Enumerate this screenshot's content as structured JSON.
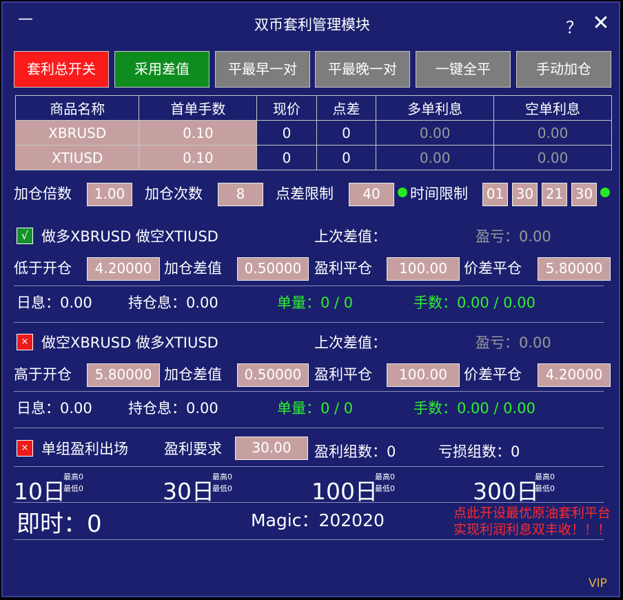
{
  "window": {
    "title": "双币套利管理模块",
    "minimize": "—",
    "help": "？",
    "close": "✕"
  },
  "toolbar": [
    {
      "label": "套利总开关",
      "color": "#fc1b1b"
    },
    {
      "label": "采用差值",
      "color": "#0f8c1e"
    },
    {
      "label": "平最早一对",
      "color": "#7d7d7d"
    },
    {
      "label": "平最晚一对",
      "color": "#7d7d7d"
    },
    {
      "label": "一键全平",
      "color": "#7d7d7d"
    },
    {
      "label": "手动加仓",
      "color": "#7d7d7d"
    }
  ],
  "table": {
    "headers": [
      "商品名称",
      "首单手数",
      "现价",
      "点差",
      "多单利息",
      "空单利息"
    ],
    "rows": [
      [
        "XBRUSD",
        "0.10",
        "0",
        "0",
        "0.00",
        "0.00"
      ],
      [
        "XTIUSD",
        "0.10",
        "0",
        "0",
        "0.00",
        "0.00"
      ]
    ]
  },
  "params": {
    "add_multiplier_label": "加仓倍数",
    "add_multiplier": "1.00",
    "add_count_label": "加仓次数",
    "add_count": "8",
    "spread_limit_label": "点差限制",
    "spread_limit": "40",
    "time_limit_label": "时间限制",
    "time_limit": [
      "01",
      "30",
      "21",
      "30"
    ]
  },
  "long_group": {
    "check": "√",
    "title": "做多XBRUSD 做空XTIUSD",
    "last_diff_label": "上次差值：",
    "pnl": "盈亏：0.00",
    "open_label": "低于开仓",
    "open_value": "4.20000",
    "add_diff_label": "加仓差值",
    "add_diff": "0.50000",
    "profit_close_label": "盈利平仓",
    "profit_close": "100.00",
    "spread_close_label": "价差平仓",
    "spread_close": "5.80000",
    "daily_interest": "日息：0.00",
    "hold_interest": "持仓息：0.00",
    "orders": "单量：0 / 0",
    "lots": "手数：0.00 / 0.00"
  },
  "short_group": {
    "check": "×",
    "title": "做空XBRUSD 做多XTIUSD",
    "last_diff_label": "上次差值：",
    "pnl": "盈亏：0.00",
    "open_label": "高于开仓",
    "open_value": "5.80000",
    "add_diff_label": "加仓差值",
    "add_diff": "0.50000",
    "profit_close_label": "盈利平仓",
    "profit_close": "100.00",
    "spread_close_label": "价差平仓",
    "spread_close": "4.20000",
    "daily_interest": "日息：0.00",
    "hold_interest": "持仓息：0.00",
    "orders": "单量：0 / 0",
    "lots": "手数：0.00 / 0.00"
  },
  "group_exit": {
    "check": "×",
    "label": "单组盈利出场",
    "req_label": "盈利要求",
    "req_value": "30.00",
    "profit_groups": "盈利组数：0",
    "loss_groups": "亏损组数：0"
  },
  "stats": [
    {
      "period": "10日",
      "high": "最高0",
      "low": "最低0"
    },
    {
      "period": "30日",
      "high": "最高0",
      "low": "最低0"
    },
    {
      "period": "100日",
      "high": "最高0",
      "low": "最低0"
    },
    {
      "period": "300日",
      "high": "最高0",
      "low": "最低0"
    }
  ],
  "footer": {
    "realtime": "即时：0",
    "magic": "Magic：202020",
    "ad_line1": "点此开设最优原油套利平台",
    "ad_line2": "实现利润利息双丰收！！！",
    "vip": "VIP"
  }
}
